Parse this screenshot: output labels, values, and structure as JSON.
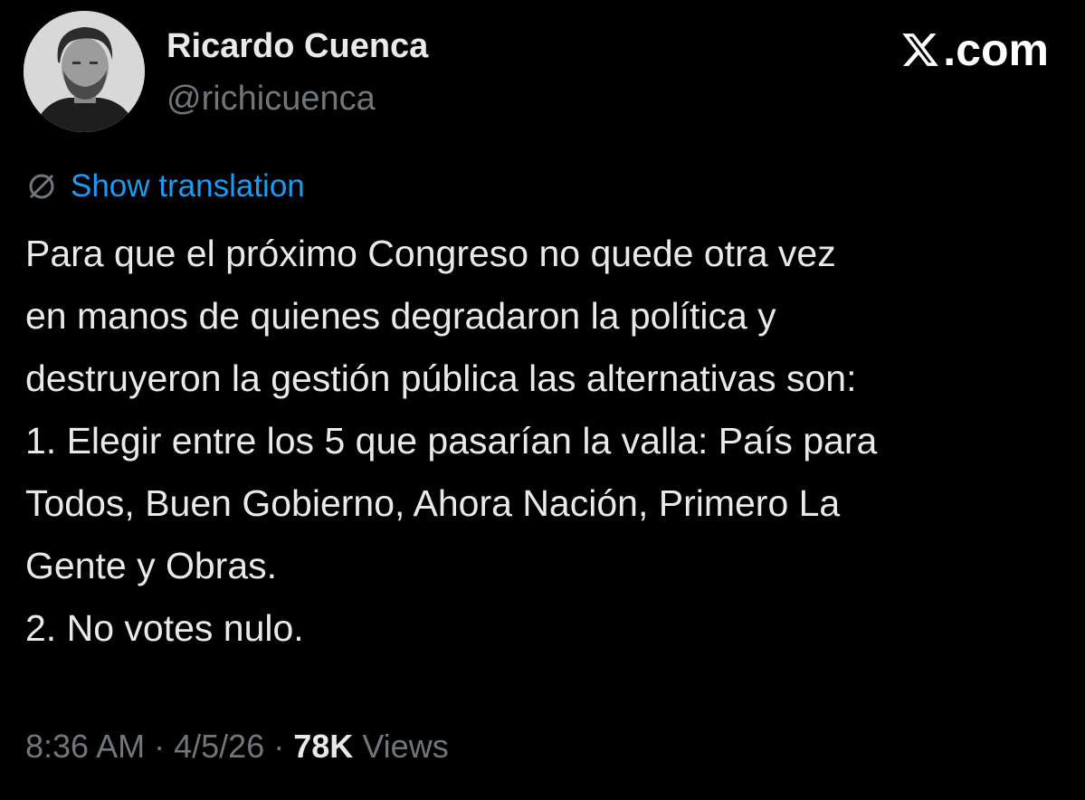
{
  "author": {
    "name": "Ricardo Cuenca",
    "handle": "@richicuenca",
    "avatar": "profile-photo"
  },
  "brand": {
    "icon": "x-logo-icon",
    "suffix": ".com"
  },
  "translation": {
    "icon": "globe-icon",
    "label": "Show translation",
    "color": "#1d9bf0"
  },
  "tweet": {
    "lines": [
      "Para que el próximo Congreso no quede otra vez",
      "en manos de quienes degradaron la política y",
      "destruyeron la gestión pública las alternativas son:",
      "1. Elegir entre los 5 que pasarían la valla: País para",
      "Todos, Buen Gobierno, Ahora Nación, Primero La",
      "Gente y Obras.",
      "2. No votes nulo."
    ]
  },
  "meta": {
    "time": "8:36 AM",
    "separator": "·",
    "date": "4/5/26",
    "views_count": "78K",
    "views_label": "Views"
  },
  "colors": {
    "background": "#000000",
    "text": "#e7e9ea",
    "muted": "#71767b",
    "link": "#1d9bf0"
  }
}
